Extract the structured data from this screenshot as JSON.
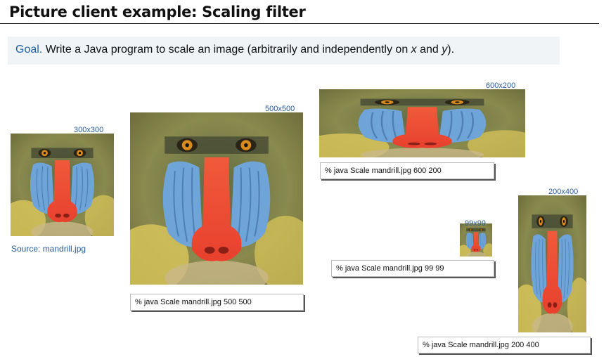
{
  "title": "Picture client example: Scaling filter",
  "goal": {
    "lead": "Goal.",
    "text_a": " Write a Java program to scale an image (arbitrarily and independently on ",
    "x": "x",
    "and": " and ",
    "y": "y",
    "end": ")."
  },
  "source_label": "Source: mandrill.jpg",
  "images": [
    {
      "label": "300x300"
    },
    {
      "label": "500x500"
    },
    {
      "label": "600x200"
    },
    {
      "label": "99x99"
    },
    {
      "label": "200x400"
    }
  ],
  "commands": [
    "% java Scale mandrill.jpg 500 500",
    "% java Scale mandrill.jpg 600 200",
    "% java Scale mandrill.jpg 99 99",
    "% java Scale mandrill.jpg 200 400"
  ],
  "colors": {
    "nose": "#e8412e",
    "cheek": "#6fa4d8",
    "fur": "#8a8a4e",
    "beard": "#d7c45a",
    "eye": "#d88a1c"
  }
}
